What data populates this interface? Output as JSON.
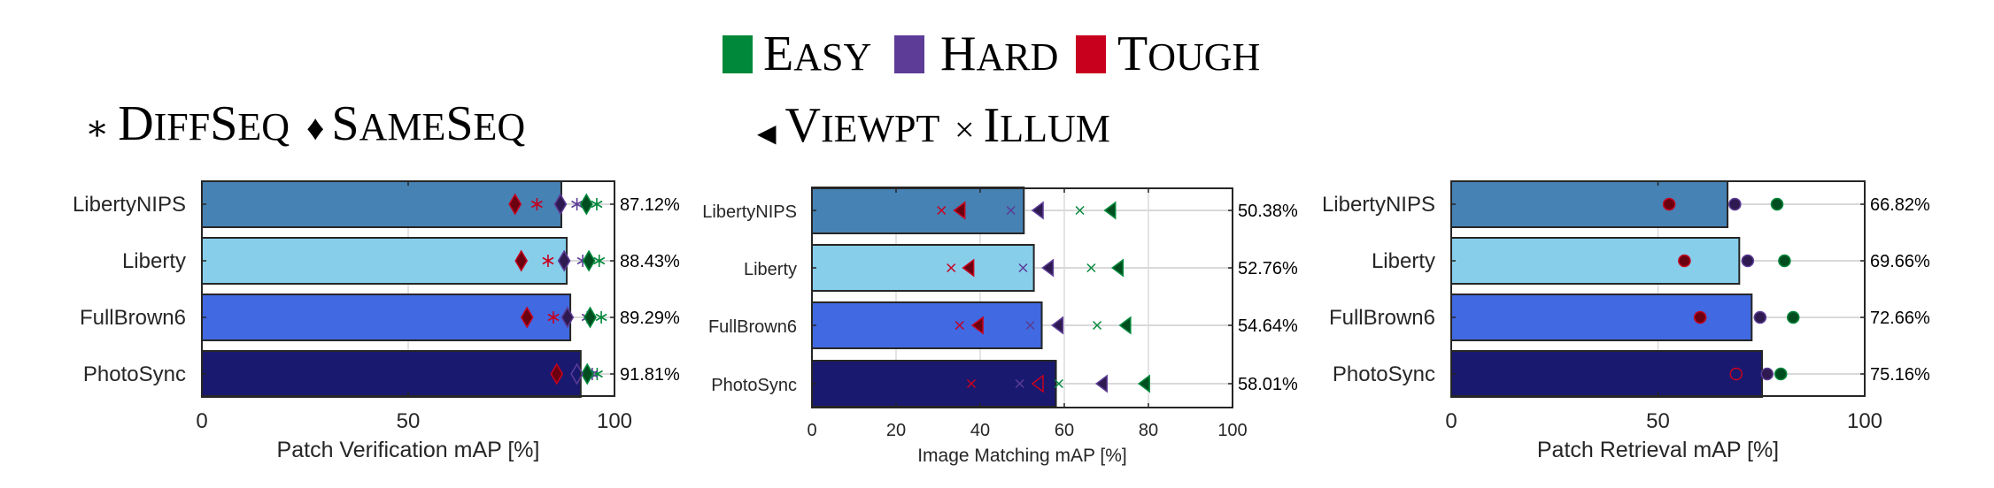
{
  "legend_difficulty": {
    "items": [
      {
        "label_first": "E",
        "label_rest": "ASY",
        "color": "#00883a"
      },
      {
        "label_first": "H",
        "label_rest": "ARD",
        "color": "#5c3c96"
      },
      {
        "label_first": "T",
        "label_rest": "OUGH",
        "color": "#c8001e"
      }
    ]
  },
  "legend_markers_left": {
    "items": [
      {
        "symbol": "∗",
        "parts": [
          [
            "D",
            "big"
          ],
          [
            "IFF",
            "small"
          ],
          [
            "S",
            "big"
          ],
          [
            "EQ",
            "small"
          ]
        ]
      },
      {
        "symbol": "♦",
        "parts": [
          [
            "S",
            "big"
          ],
          [
            "AME",
            "small"
          ],
          [
            "S",
            "big"
          ],
          [
            "EQ",
            "small"
          ]
        ]
      }
    ]
  },
  "legend_markers_mid": {
    "items": [
      {
        "symbol": "◀",
        "parts": [
          [
            "V",
            "big"
          ],
          [
            "IEWPT",
            "small"
          ]
        ]
      },
      {
        "symbol": "×",
        "parts": [
          [
            "I",
            "big"
          ],
          [
            "LLUM",
            "small"
          ]
        ]
      }
    ]
  },
  "colors": {
    "bars": [
      "#4682b4",
      "#87ceeb",
      "#4169e1",
      "#191970"
    ],
    "easy": "#00883a",
    "easy_fill": "#004d20",
    "hard": "#5c3c96",
    "hard_fill": "#2e1a50",
    "tough": "#c8001e",
    "tough_fill": "#6b0010"
  },
  "chart_data": [
    {
      "type": "bar",
      "orientation": "horizontal",
      "title": "",
      "xlabel": "Patch Verification mAP [%]",
      "ylabel": "",
      "xlim": [
        0,
        100
      ],
      "xticks": [
        0,
        50,
        100
      ],
      "grid": true,
      "categories": [
        "LibertyNIPS",
        "Liberty",
        "FullBrown6",
        "PhotoSync"
      ],
      "values": [
        87.12,
        88.43,
        89.29,
        91.81
      ],
      "value_labels": [
        "87.12%",
        "88.43%",
        "89.29%",
        "91.81%"
      ],
      "marker_series": [
        {
          "name": "DiffSeq Easy",
          "marker": "star",
          "difficulty": "easy",
          "values": [
            95.7,
            96.3,
            96.8,
            95.8
          ]
        },
        {
          "name": "DiffSeq Hard",
          "marker": "star",
          "difficulty": "hard",
          "values": [
            90.9,
            92.3,
            93.4,
            94.6
          ]
        },
        {
          "name": "DiffSeq Tough",
          "marker": "star",
          "difficulty": "tough",
          "values": [
            81.2,
            83.9,
            85.2,
            null
          ]
        },
        {
          "name": "SameSeq Easy",
          "marker": "diamond",
          "difficulty": "easy",
          "values": [
            93.2,
            93.8,
            94.1,
            93.4
          ]
        },
        {
          "name": "SameSeq Hard",
          "marker": "diamond",
          "difficulty": "hard",
          "values": [
            86.9,
            87.8,
            88.6,
            90.9
          ]
        },
        {
          "name": "SameSeq Tough",
          "marker": "diamond",
          "difficulty": "tough",
          "values": [
            75.9,
            77.4,
            78.8,
            86.0
          ]
        }
      ]
    },
    {
      "type": "bar",
      "orientation": "horizontal",
      "title": "",
      "xlabel": "Image Matching mAP [%]",
      "ylabel": "",
      "xlim": [
        0,
        100
      ],
      "xticks": [
        0,
        20,
        40,
        60,
        80,
        100
      ],
      "grid": true,
      "categories": [
        "LibertyNIPS",
        "Liberty",
        "FullBrown6",
        "PhotoSync"
      ],
      "values": [
        50.38,
        52.76,
        54.64,
        58.01
      ],
      "value_labels": [
        "50.38%",
        "52.76%",
        "54.64%",
        "58.01%"
      ],
      "marker_series": [
        {
          "name": "Viewpt Easy",
          "marker": "triangle-left",
          "difficulty": "easy",
          "values": [
            71.1,
            72.9,
            74.7,
            79.2
          ]
        },
        {
          "name": "Viewpt Hard",
          "marker": "triangle-left",
          "difficulty": "hard",
          "values": [
            53.9,
            56.3,
            58.6,
            69.1
          ]
        },
        {
          "name": "Viewpt Tough",
          "marker": "triangle-left",
          "difficulty": "tough",
          "values": [
            35.3,
            37.4,
            39.6,
            53.9
          ]
        },
        {
          "name": "Illum Easy",
          "marker": "x",
          "difficulty": "easy",
          "values": [
            63.7,
            66.4,
            67.8,
            58.7
          ]
        },
        {
          "name": "Illum Hard",
          "marker": "x",
          "difficulty": "hard",
          "values": [
            47.3,
            50.2,
            51.9,
            49.4
          ]
        },
        {
          "name": "Illum Tough",
          "marker": "x",
          "difficulty": "tough",
          "values": [
            30.8,
            33.1,
            35.1,
            37.9
          ]
        }
      ]
    },
    {
      "type": "bar",
      "orientation": "horizontal",
      "title": "",
      "xlabel": "Patch Retrieval mAP [%]",
      "ylabel": "",
      "xlim": [
        0,
        100
      ],
      "xticks": [
        0,
        50,
        100
      ],
      "grid": true,
      "categories": [
        "LibertyNIPS",
        "Liberty",
        "FullBrown6",
        "PhotoSync"
      ],
      "values": [
        66.82,
        69.66,
        72.66,
        75.16
      ],
      "value_labels": [
        "66.82%",
        "69.66%",
        "72.66%",
        "75.16%"
      ],
      "marker_series": [
        {
          "name": "Easy",
          "marker": "circle",
          "difficulty": "easy",
          "values": [
            78.8,
            80.6,
            82.7,
            79.7
          ]
        },
        {
          "name": "Hard",
          "marker": "circle",
          "difficulty": "hard",
          "values": [
            68.6,
            71.7,
            74.7,
            76.4
          ]
        },
        {
          "name": "Tough",
          "marker": "circle",
          "difficulty": "tough",
          "values": [
            52.7,
            56.4,
            60.2,
            68.9
          ]
        }
      ]
    }
  ]
}
